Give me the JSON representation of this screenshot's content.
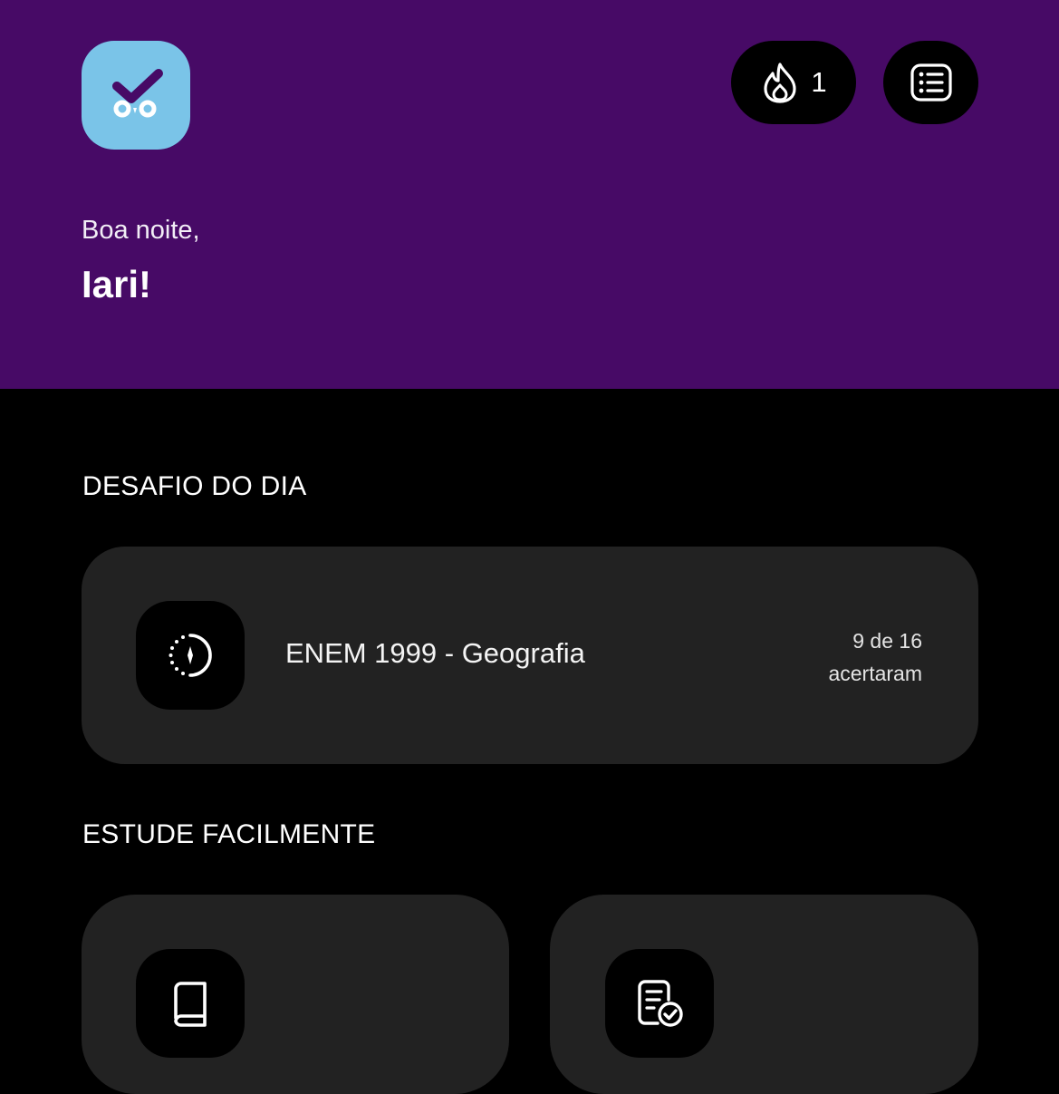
{
  "header": {
    "streak_count": "1",
    "greeting": "Boa noite,",
    "username": "Iari!"
  },
  "daily_challenge": {
    "section_title": "DESAFIO DO DIA",
    "title": "ENEM 1999 - Geografia",
    "stat_line1": "9 de 16",
    "stat_line2": "acertaram"
  },
  "study": {
    "section_title": "ESTUDE FACILMENTE"
  },
  "colors": {
    "header_bg": "#470a66",
    "logo_bg": "#7ac4e8",
    "card_bg": "#222222",
    "page_bg": "#000000"
  }
}
